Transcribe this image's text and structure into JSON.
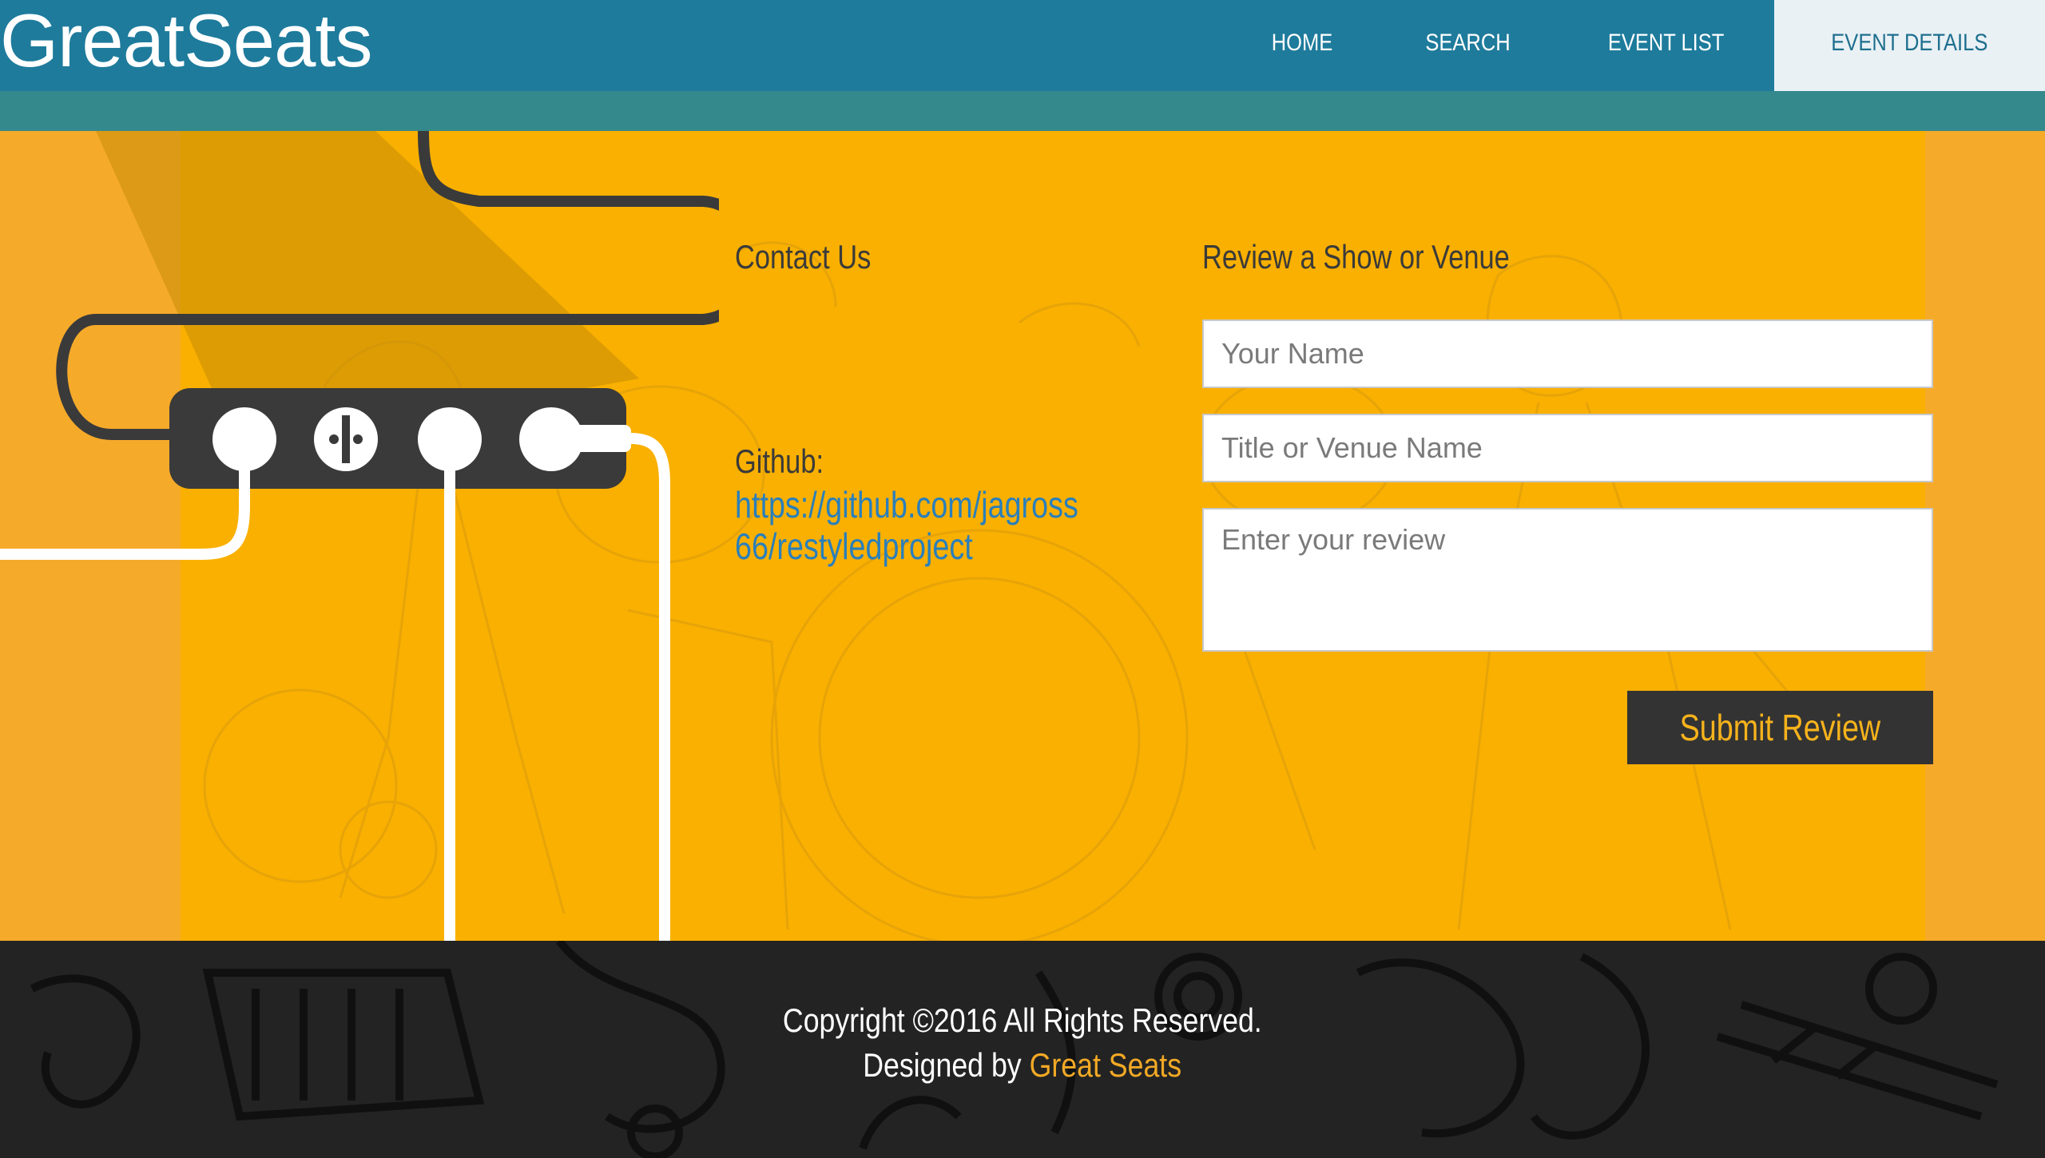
{
  "brand": "GreatSeats",
  "nav": {
    "items": [
      {
        "label": "HOME"
      },
      {
        "label": "SEARCH"
      },
      {
        "label": "EVENT LIST"
      },
      {
        "label": "EVENT DETAILS",
        "active": true
      }
    ]
  },
  "contact": {
    "heading": "Contact Us",
    "github_label": "Github:",
    "github_url": "https://github.com/jagross66/restyledproject"
  },
  "review": {
    "heading": "Review a Show or Venue",
    "name_placeholder": "Your Name",
    "title_placeholder": "Title or Venue Name",
    "review_placeholder": "Enter your review",
    "submit_label": "Submit Review"
  },
  "footer": {
    "copyright": "Copyright ©2016 All Rights Reserved.",
    "designed_by": "Designed by",
    "designer": "Great Seats"
  },
  "colors": {
    "header": "#1e7b9c",
    "subbar": "#34898c",
    "band": "#f9b000",
    "footer": "#232323",
    "accent": "#f2a925"
  }
}
